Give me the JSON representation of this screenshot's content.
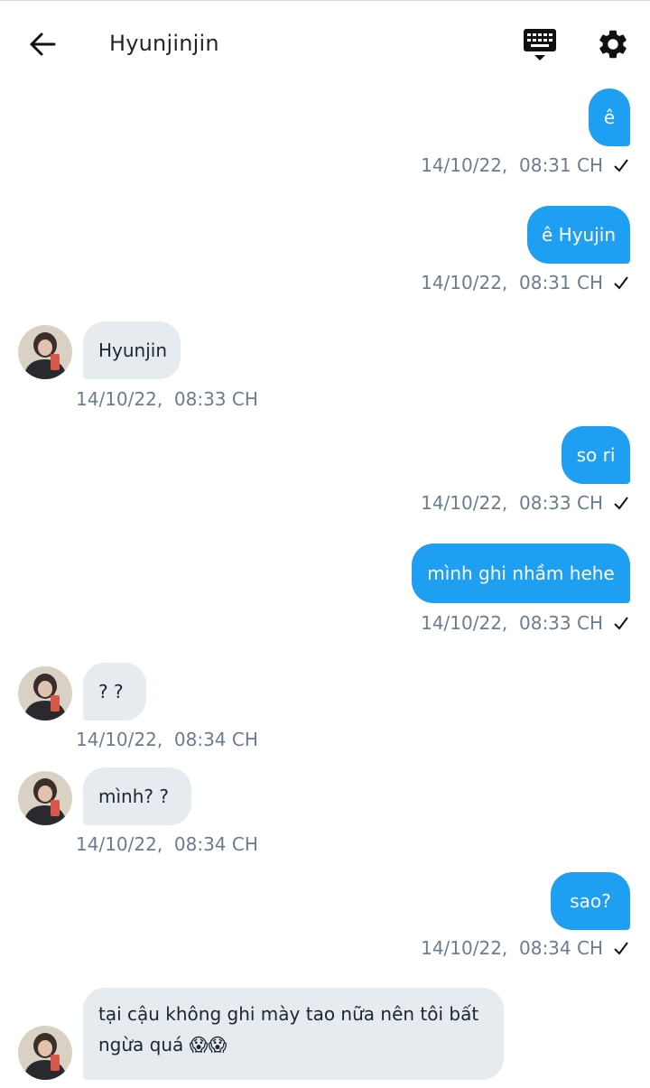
{
  "header": {
    "title": "Hyunjinjin",
    "back_icon": "arrow-left-icon",
    "keyboard_icon": "keyboard-icon",
    "settings_icon": "gear-icon"
  },
  "colors": {
    "outgoing_bubble": "#1e9ff2",
    "incoming_bubble": "#e6ebf0",
    "timestamp": "#6b7c8e"
  },
  "messages": [
    {
      "direction": "out",
      "text": "ê",
      "time": "14/10/22,  08:31 CH",
      "read_icon": "check-icon"
    },
    {
      "direction": "out",
      "text": "ê Hyujin",
      "time": "14/10/22,  08:31 CH",
      "read_icon": "check-icon"
    },
    {
      "direction": "in",
      "text": "Hyunjin",
      "time": "14/10/22,  08:33 CH"
    },
    {
      "direction": "out",
      "text": "so ri",
      "time": "14/10/22,  08:33 CH",
      "read_icon": "check-icon"
    },
    {
      "direction": "out",
      "text": "mình ghi nhầm hehe",
      "time": "14/10/22,  08:33 CH",
      "read_icon": "check-icon"
    },
    {
      "direction": "in",
      "text": "? ?",
      "time": "14/10/22,  08:34 CH"
    },
    {
      "direction": "in",
      "text": "mình? ?",
      "time": "14/10/22,  08:34 CH"
    },
    {
      "direction": "out",
      "text": "sao?",
      "time": "14/10/22,  08:34 CH",
      "read_icon": "check-icon"
    },
    {
      "direction": "in",
      "text": "tại cậu không ghi mày tao nữa nên tôi bất ngừa quá 😱😱"
    }
  ]
}
